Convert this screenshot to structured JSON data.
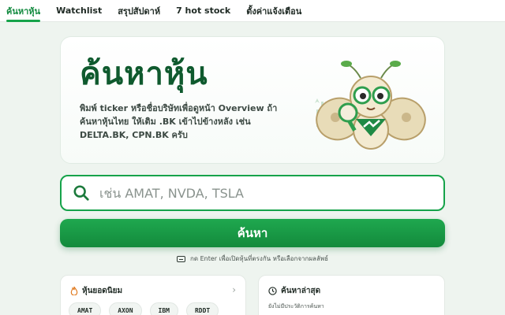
{
  "nav": {
    "tabs": [
      {
        "label": "ค้นหาหุ้น",
        "active": true
      },
      {
        "label": "Watchlist"
      },
      {
        "label": "สรุปสัปดาห์"
      },
      {
        "label": "7 hot stock"
      },
      {
        "label": "ตั้งค่าแจ้งเตือน"
      }
    ]
  },
  "hero": {
    "title": "ค้นหาหุ้น",
    "description": "พิมพ์ ticker หรือชื่อบริษัทเพื่อดูหน้า Overview ถ้าค้นหาหุ้นไทย ให้เติม .BK เข้าไปข้างหลัง เช่น DELTA.BK, CPN.BK ครับ",
    "mascot_icon": "moth-mascot-magnifier-icon"
  },
  "search": {
    "placeholder": "เช่น AMAT, NVDA, TSLA",
    "value": "",
    "button_label": "ค้นหา",
    "hint": "กด Enter เพื่อเปิดหุ้นที่ตรงกัน หรือเลือกจากผลลัพธ์"
  },
  "popular": {
    "title": "หุ้นยอดนิยม",
    "icon": "flame-icon",
    "tickers": [
      "AMAT",
      "AXON",
      "IBM",
      "RDDT"
    ]
  },
  "recent": {
    "title": "ค้นหาล่าสุด",
    "icon": "clock-icon",
    "empty_text": "ยังไม่มีประวัติการค้นหา"
  },
  "colors": {
    "accent": "#16a34a",
    "title": "#0f5a2e",
    "background": "#eef4ef"
  }
}
